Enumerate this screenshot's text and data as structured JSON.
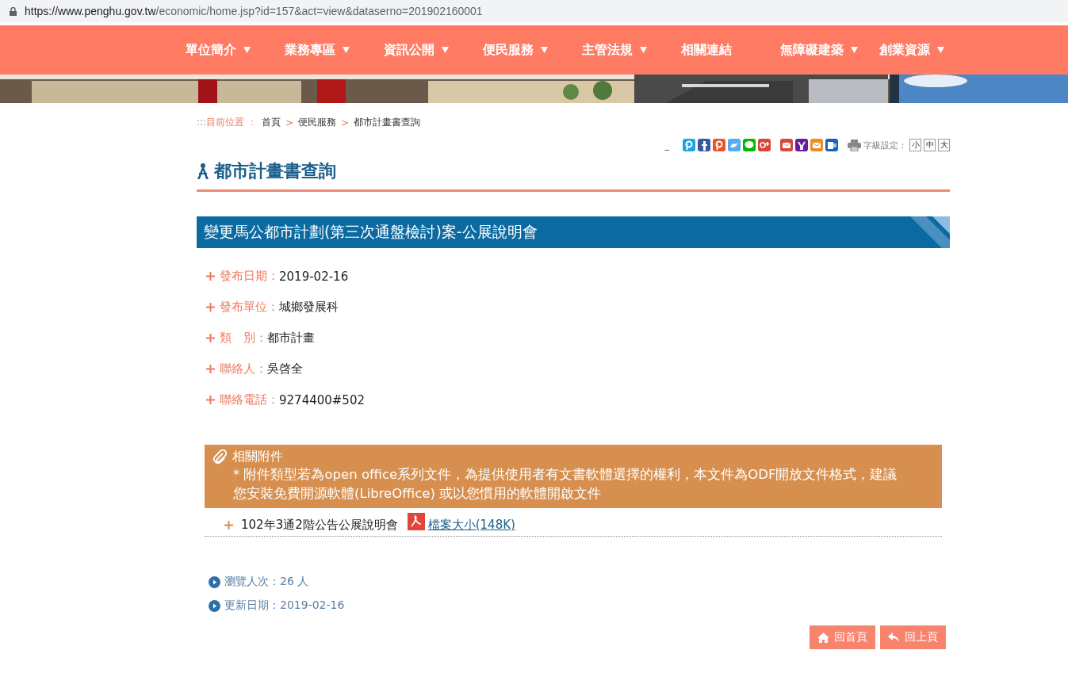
{
  "address_bar": {
    "url_host": "https://www.penghu.gov.tw",
    "url_path": "/economic/home.jsp?id=157&act=view&dataserno=201902160001"
  },
  "nav": [
    {
      "label": "單位簡介",
      "dropdown": true
    },
    {
      "label": "業務專區",
      "dropdown": true
    },
    {
      "label": "資訊公開",
      "dropdown": true
    },
    {
      "label": "便民服務",
      "dropdown": true
    },
    {
      "label": "主管法規",
      "dropdown": true
    },
    {
      "label": "相關連結",
      "dropdown": false
    },
    {
      "label": "無障礙建築",
      "dropdown": true
    },
    {
      "label": "創業資源",
      "dropdown": true
    }
  ],
  "breadcrumb": {
    "prefix": ":::",
    "label": "目前位置 ：",
    "items": [
      {
        "label": "首頁"
      },
      {
        "label": "便民服務",
        "separator": ">"
      },
      {
        "label": "都市計畫書查詢",
        "separator": ">"
      }
    ]
  },
  "toolbar": {
    "skip_link": "_",
    "share": [
      {
        "kind": "plurk",
        "color": "#1fa3e0"
      },
      {
        "kind": "facebook",
        "color": "#3b5998"
      },
      {
        "kind": "plurk2",
        "color": "#e8542a"
      },
      {
        "kind": "twitter",
        "color": "#55acee"
      },
      {
        "kind": "line",
        "color": "#00b900"
      },
      {
        "kind": "gplus",
        "color": "#d34836"
      },
      {
        "kind": "gmail",
        "color": "#d9473b"
      },
      {
        "kind": "yahoo",
        "color": "#6a1b9a"
      },
      {
        "kind": "mail",
        "color": "#f08c1f"
      },
      {
        "kind": "outlook",
        "color": "#1565c0"
      }
    ],
    "font_label": "字級設定：",
    "font_sizes": [
      {
        "label": "小"
      },
      {
        "label": "中"
      },
      {
        "label": "大"
      }
    ]
  },
  "page_title": "都市計畫書查詢",
  "article": {
    "title": "變更馬公都市計劃(第三次通盤檢討)案-公展說明會",
    "fields": [
      {
        "label": "發布日期：",
        "value": "2019-02-16"
      },
      {
        "label": "發布單位：",
        "value": "城鄉發展科"
      },
      {
        "label": "類　別：",
        "value": "都市計畫"
      },
      {
        "label": "聯絡人：",
        "value": "吳啓全"
      },
      {
        "label": "聯絡電話：",
        "value": "9274400#502"
      }
    ]
  },
  "attachments": {
    "title": "相關附件",
    "note": " * 附件類型若為open office系列文件，為提供使用者有文書軟體選擇的權利，本文件為ODF開放文件格式，建議您安裝免費開源軟體(LibreOffice) 或以您慣用的軟體開啟文件",
    "files": [
      {
        "name": "102年3通2階公告公展說明會",
        "link": " 檔案大小(148K)"
      }
    ]
  },
  "stats": [
    {
      "text": "瀏覽人次：26 人"
    },
    {
      "text": "更新日期：2019-02-16"
    }
  ],
  "buttons": [
    {
      "kind": "home",
      "label": "回首頁"
    },
    {
      "kind": "back",
      "label": "回上頁"
    }
  ]
}
